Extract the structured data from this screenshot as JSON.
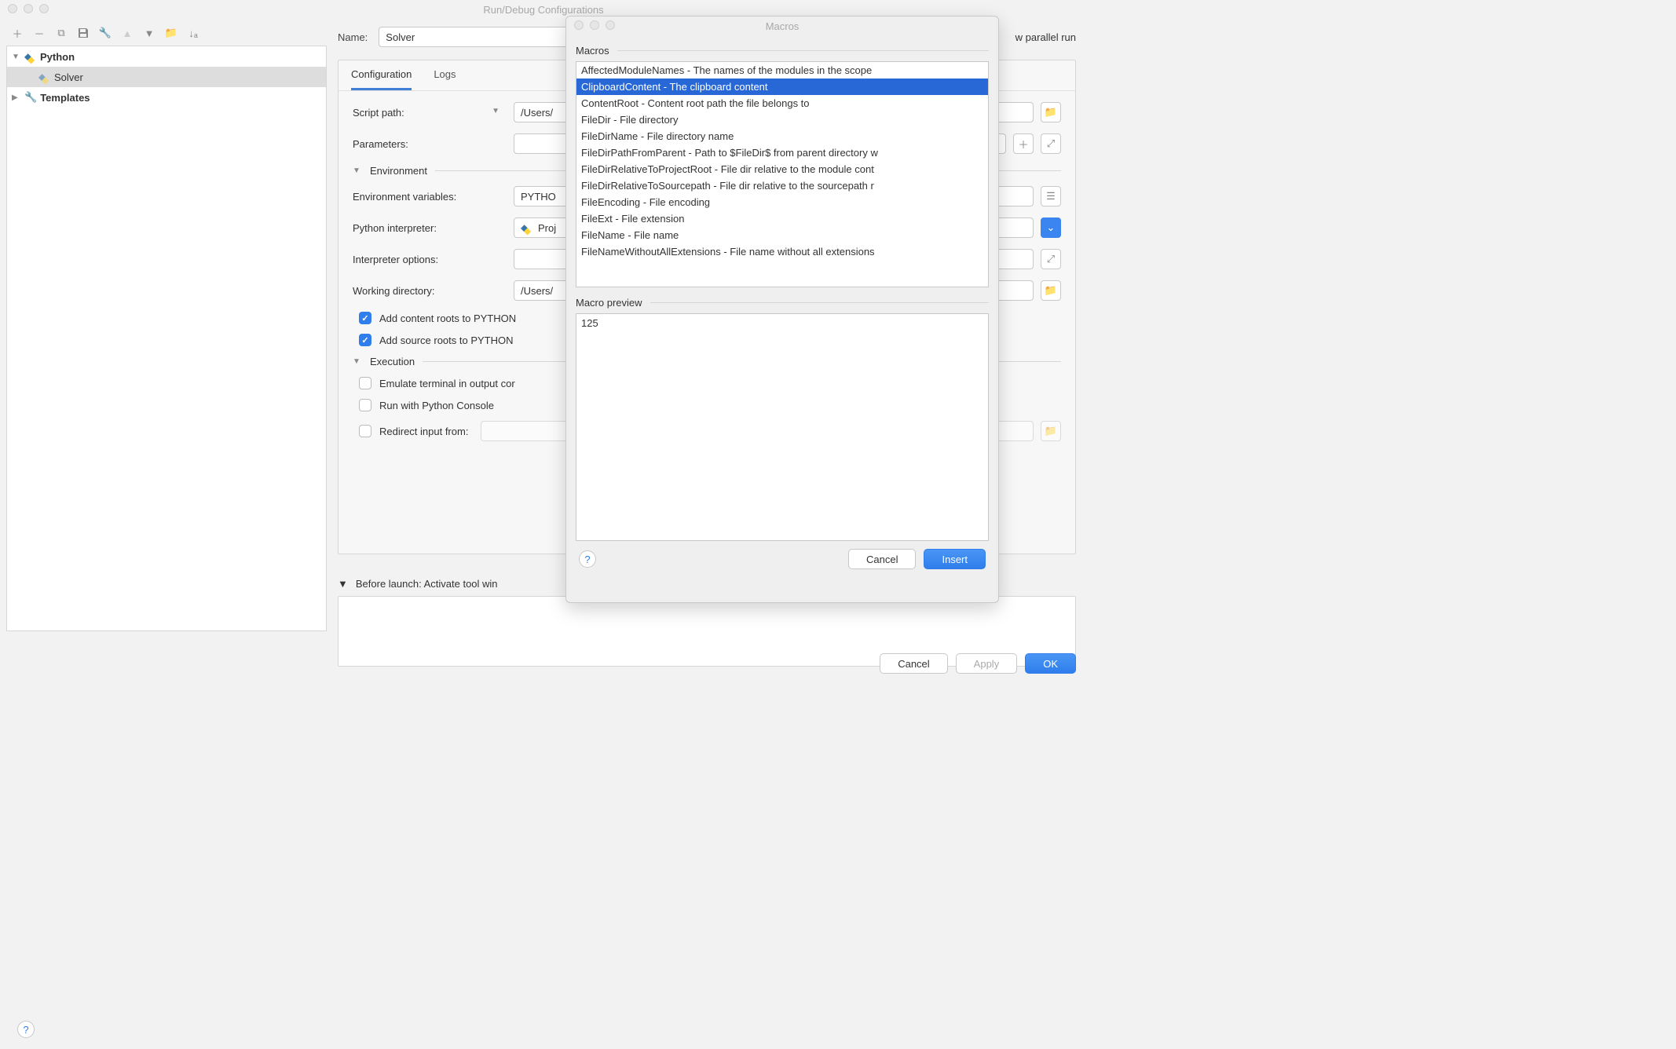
{
  "main": {
    "title": "Run/Debug Configurations",
    "name_label": "Name:",
    "name_value": "Solver",
    "allow_parallel": "w parallel run",
    "tabs": {
      "configuration": "Configuration",
      "logs": "Logs"
    },
    "form": {
      "script_path_label": "Script path:",
      "script_path_value": "/Users/",
      "parameters_label": "Parameters:",
      "env_section": "Environment",
      "env_vars_label": "Environment variables:",
      "env_vars_value": "PYTHO",
      "interpreter_label": "Python interpreter:",
      "interpreter_value": "Proj",
      "interp_options_label": "Interpreter options:",
      "working_dir_label": "Working directory:",
      "working_dir_value": "/Users/",
      "add_content_roots": "Add content roots to PYTHON",
      "add_source_roots": "Add source roots to PYTHON",
      "execution_section": "Execution",
      "emulate_terminal": "Emulate terminal in output cor",
      "run_console": "Run with Python Console",
      "redirect_input": "Redirect input from:"
    },
    "before_launch_label": "Before launch: Activate tool win",
    "buttons": {
      "cancel": "Cancel",
      "apply": "Apply",
      "ok": "OK"
    }
  },
  "tree": {
    "python": "Python",
    "solver": "Solver",
    "templates": "Templates"
  },
  "macros": {
    "title": "Macros",
    "list_label": "Macros",
    "preview_label": "Macro preview",
    "preview_value": "125",
    "items": [
      "AffectedModuleNames - The names of the modules in the scope",
      "ClipboardContent - The clipboard content",
      "ContentRoot - Content root path the file belongs to",
      "FileDir - File directory",
      "FileDirName - File directory name",
      "FileDirPathFromParent - Path to $FileDir$ from parent directory w",
      "FileDirRelativeToProjectRoot - File dir relative to the module cont",
      "FileDirRelativeToSourcepath - File dir relative to the sourcepath r",
      "FileEncoding - File encoding",
      "FileExt - File extension",
      "FileName - File name",
      "FileNameWithoutAllExtensions - File name without all extensions"
    ],
    "selected_index": 1,
    "buttons": {
      "cancel": "Cancel",
      "insert": "Insert"
    }
  }
}
